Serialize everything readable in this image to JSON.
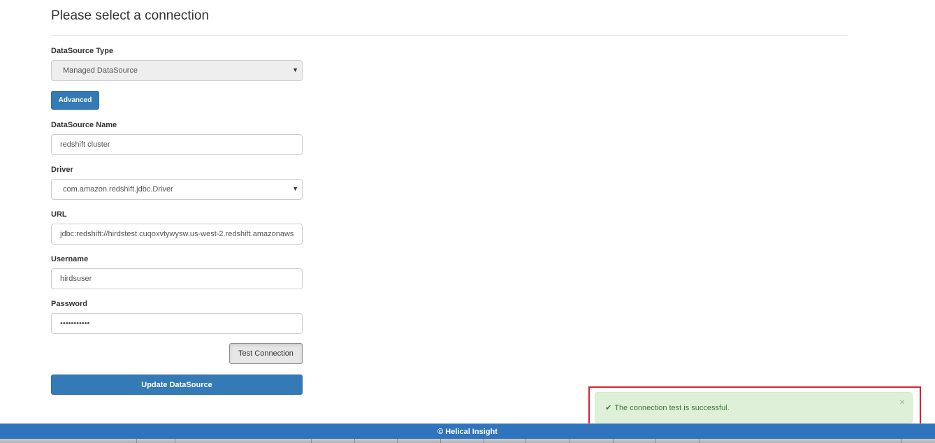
{
  "page": {
    "title": "Please select a connection"
  },
  "form": {
    "datasource_type": {
      "label": "DataSource Type",
      "value": "Managed DataSource"
    },
    "advanced_label": "Advanced",
    "datasource_name": {
      "label": "DataSource Name",
      "value": "redshift cluster"
    },
    "driver": {
      "label": "Driver",
      "value": "com.amazon.redshift.jdbc.Driver"
    },
    "url": {
      "label": "URL",
      "value": "jdbc:redshift://hirdstest.cuqoxvtywysw.us-west-2.redshift.amazonaws"
    },
    "username": {
      "label": "Username",
      "value": "hirdsuser"
    },
    "password": {
      "label": "Password",
      "value": "•••••••••••"
    },
    "test_connection_label": "Test Connection",
    "update_label": "Update DataSource"
  },
  "alert": {
    "message": "The connection test is successful.",
    "close": "×",
    "check": "✔"
  },
  "footer": {
    "text": "© Helical Insight"
  },
  "colors": {
    "primary": "#337ab7",
    "alert_bg": "#dff0d8",
    "alert_text": "#3c763d",
    "highlight": "#d9232f",
    "footer_bg": "#2f74bd"
  }
}
